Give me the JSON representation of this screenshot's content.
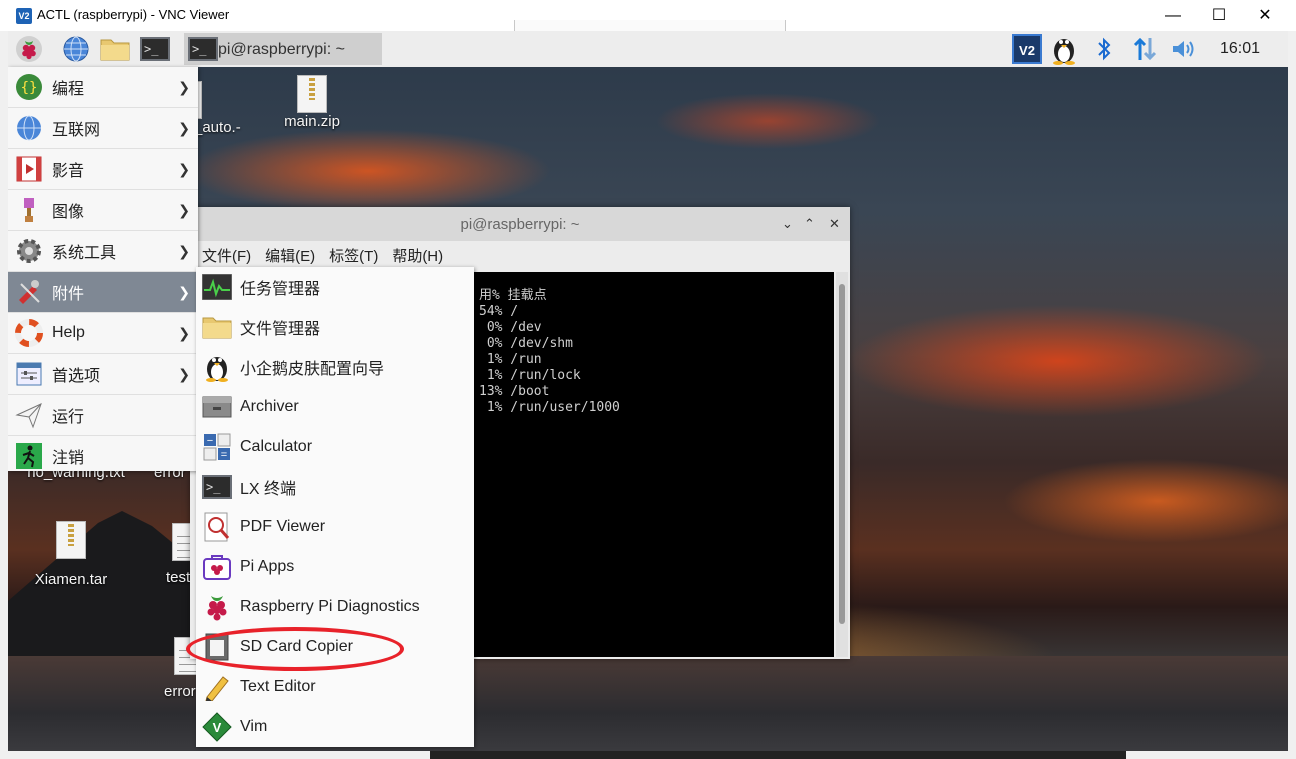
{
  "window": {
    "icon_text": "V2",
    "title": "ACTL (raspberrypi) - VNC Viewer",
    "minimize": "—",
    "maximize": "☐",
    "close": "✕"
  },
  "panel": {
    "task_label": "pi@raspberrypi: ~",
    "clock": "16:01",
    "tray_icons": [
      "vnc-icon",
      "penguin-icon",
      "bluetooth-icon",
      "network-icon",
      "volume-icon"
    ]
  },
  "desktop": {
    "icons": [
      {
        "label": "_auto.-"
      },
      {
        "label": "main.zip"
      },
      {
        "label": "no_warning.txt"
      },
      {
        "label": "error"
      },
      {
        "label": "Xiamen.tar"
      },
      {
        "label": "test"
      },
      {
        "label": "error"
      }
    ]
  },
  "terminal": {
    "title": "pi@raspberrypi: ~",
    "menu": [
      "文件(F)",
      "编辑(E)",
      "标签(T)",
      "帮助(H)"
    ],
    "output": "用% 挂载点\n54% /\n 0% /dev\n 0% /dev/shm\n 1% /run\n 1% /run/lock\n13% /boot\n 1% /run/user/1000"
  },
  "main_menu": {
    "items": [
      {
        "label": "编程",
        "icon": "braces-icon",
        "has_sub": true
      },
      {
        "label": "互联网",
        "icon": "globe-icon",
        "has_sub": true
      },
      {
        "label": "影音",
        "icon": "media-icon",
        "has_sub": true
      },
      {
        "label": "图像",
        "icon": "paintbrush-icon",
        "has_sub": true
      },
      {
        "label": "系统工具",
        "icon": "gear-icon",
        "has_sub": true
      },
      {
        "label": "附件",
        "icon": "accessories-icon",
        "has_sub": true,
        "selected": true
      },
      {
        "label": "Help",
        "icon": "lifebuoy-icon",
        "has_sub": true
      },
      {
        "label": "首选项",
        "icon": "preferences-icon",
        "has_sub": true
      },
      {
        "label": "运行",
        "icon": "run-icon",
        "has_sub": false
      },
      {
        "label": "注销",
        "icon": "logout-icon",
        "has_sub": false
      }
    ]
  },
  "sub_menu": {
    "items": [
      {
        "label": "任务管理器",
        "icon": "task-manager-icon"
      },
      {
        "label": "文件管理器",
        "icon": "folder-icon"
      },
      {
        "label": "小企鹅皮肤配置向导",
        "icon": "penguin-icon"
      },
      {
        "label": "Archiver",
        "icon": "archiver-icon"
      },
      {
        "label": "Calculator",
        "icon": "calculator-icon"
      },
      {
        "label": "LX 终端",
        "icon": "terminal-icon"
      },
      {
        "label": "PDF Viewer",
        "icon": "pdf-viewer-icon"
      },
      {
        "label": "Pi Apps",
        "icon": "pi-apps-icon"
      },
      {
        "label": "Raspberry Pi Diagnostics",
        "icon": "raspberry-icon"
      },
      {
        "label": "SD Card Copier",
        "icon": "sd-card-icon"
      },
      {
        "label": "Text Editor",
        "icon": "pencil-icon"
      },
      {
        "label": "Vim",
        "icon": "vim-icon"
      }
    ]
  },
  "colors": {
    "menu_selected": "#7f8894",
    "highlight_circle": "#e8222a",
    "terminal_bg": "#000000"
  }
}
